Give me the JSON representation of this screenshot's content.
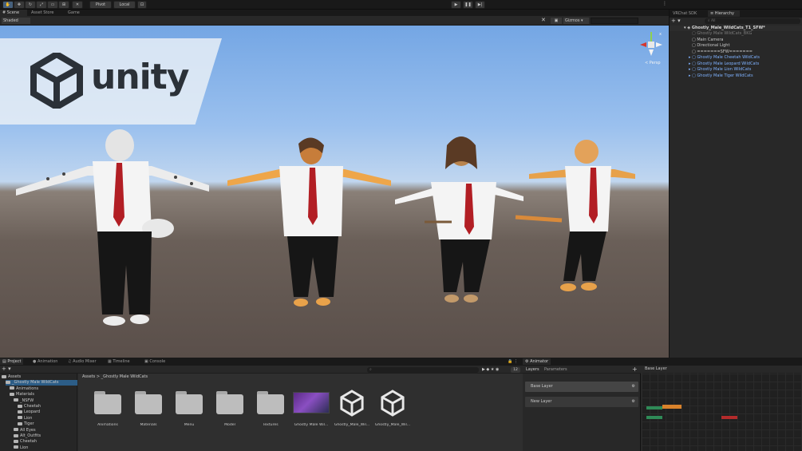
{
  "toolbar": {
    "pivot_label": "Pivot",
    "local_label": "Local"
  },
  "scene": {
    "tabs": [
      "Scene",
      "Asset Store",
      "Game"
    ],
    "shaded_label": "Shaded",
    "gizmos_label": "Gizmos",
    "persp_label": "< Persp",
    "logo_text": "unity"
  },
  "hierarchy": {
    "tab_vrchat": "VRChat SDK",
    "tab_hierarchy": "Hierarchy",
    "search_placeholder": "All",
    "scene_name": "Ghostly_Male_WildCats_T1_SFW*",
    "items": [
      {
        "label": "Ghostly Male WildCats_BKG",
        "color": "#7c7c7c"
      },
      {
        "label": "Main Camera",
        "color": "#c8c8c8"
      },
      {
        "label": "Directional Light",
        "color": "#c8c8c8"
      },
      {
        "label": "=======SFW=======",
        "color": "#c8c8c8"
      },
      {
        "label": "Ghostly Male Cheetah WildCats",
        "color": "#7fb2ff"
      },
      {
        "label": "Ghostly Male Leopard WildCats",
        "color": "#7fb2ff"
      },
      {
        "label": "Ghostly Male Lion WildCats",
        "color": "#7fb2ff"
      },
      {
        "label": "Ghostly Male Tiger WildCats",
        "color": "#7fb2ff"
      }
    ]
  },
  "bottom": {
    "tabs": [
      "Project",
      "Animation",
      "Audio Mixer",
      "Timeline",
      "Console"
    ],
    "breadcrumb": [
      "Assets",
      ">",
      "_Ghostly Male WildCats"
    ],
    "badge": "12",
    "tree": [
      {
        "label": "Assets",
        "indent": 0
      },
      {
        "label": "_Ghostly Male WildCats",
        "indent": 1
      },
      {
        "label": "Animations",
        "indent": 2
      },
      {
        "label": "Materials",
        "indent": 2
      },
      {
        "label": "_NSFW",
        "indent": 3
      },
      {
        "label": "Cheetah",
        "indent": 4
      },
      {
        "label": "Leopard",
        "indent": 4
      },
      {
        "label": "Lion",
        "indent": 4
      },
      {
        "label": "Tiger",
        "indent": 4
      },
      {
        "label": "All Eyes",
        "indent": 3
      },
      {
        "label": "Alt_Outfits",
        "indent": 3
      },
      {
        "label": "Cheetah",
        "indent": 3
      },
      {
        "label": "Lion",
        "indent": 3
      }
    ],
    "assets": [
      {
        "label": "Animations",
        "kind": "folder"
      },
      {
        "label": "Materials",
        "kind": "folder"
      },
      {
        "label": "Menu",
        "kind": "folder"
      },
      {
        "label": "Model",
        "kind": "folder"
      },
      {
        "label": "Textures",
        "kind": "folder"
      },
      {
        "label": "Ghostly Male Wil...",
        "kind": "image"
      },
      {
        "label": "Ghostly_Male_Wil...",
        "kind": "unity"
      },
      {
        "label": "Ghostly_Male_Wil...",
        "kind": "unity"
      }
    ]
  },
  "animator": {
    "tab": "Animator",
    "subtabs": [
      "Layers",
      "Parameters"
    ],
    "layers": [
      "Base Layer",
      "New Layer"
    ],
    "graph_title": "Base Layer"
  }
}
